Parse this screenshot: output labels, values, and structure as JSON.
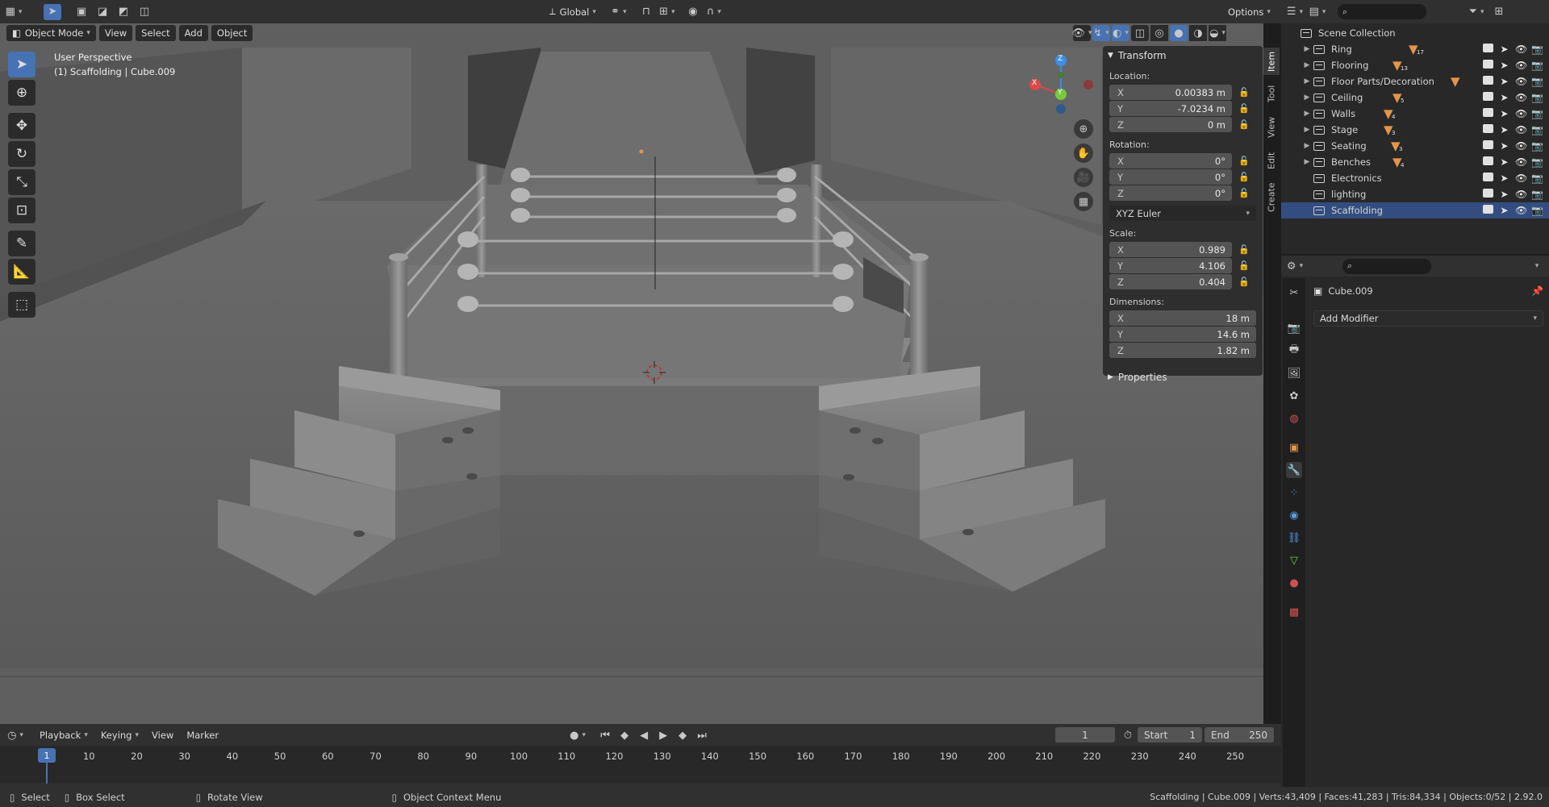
{
  "topbar": {
    "transform_orientation": "Global",
    "options": "Options"
  },
  "viewport": {
    "mode": "Object Mode",
    "menus": [
      "View",
      "Select",
      "Add",
      "Object"
    ],
    "perspective": "User Perspective",
    "object_info": "(1) Scaffolding | Cube.009"
  },
  "gizmo": {
    "x": "X",
    "y": "Y",
    "z": "Z"
  },
  "npanel": {
    "tabs": [
      "Item",
      "Tool",
      "View",
      "Edit",
      "Create"
    ],
    "transform": "Transform",
    "location_label": "Location:",
    "location": [
      {
        "axis": "X",
        "value": "0.00383 m"
      },
      {
        "axis": "Y",
        "value": "-7.0234 m"
      },
      {
        "axis": "Z",
        "value": "0 m"
      }
    ],
    "rotation_label": "Rotation:",
    "rotation": [
      {
        "axis": "X",
        "value": "0°"
      },
      {
        "axis": "Y",
        "value": "0°"
      },
      {
        "axis": "Z",
        "value": "0°"
      }
    ],
    "rotation_mode": "XYZ Euler",
    "scale_label": "Scale:",
    "scale": [
      {
        "axis": "X",
        "value": "0.989"
      },
      {
        "axis": "Y",
        "value": "4.106"
      },
      {
        "axis": "Z",
        "value": "0.404"
      }
    ],
    "dimensions_label": "Dimensions:",
    "dimensions": [
      {
        "axis": "X",
        "value": "18 m"
      },
      {
        "axis": "Y",
        "value": "14.6 m"
      },
      {
        "axis": "Z",
        "value": "1.82 m"
      }
    ],
    "properties": "Properties"
  },
  "outliner": {
    "root": "Scene Collection",
    "items": [
      {
        "label": "Ring",
        "badge": "17"
      },
      {
        "label": "Flooring",
        "badge": "13"
      },
      {
        "label": "Floor Parts/Decoration",
        "badge": ""
      },
      {
        "label": "Ceiling",
        "badge": "5"
      },
      {
        "label": "Walls",
        "badge": "4"
      },
      {
        "label": "Stage",
        "badge": "3"
      },
      {
        "label": "Seating",
        "badge": "3"
      },
      {
        "label": "Benches",
        "badge": "4"
      },
      {
        "label": "Electronics",
        "badge": ""
      },
      {
        "label": "lighting",
        "badge": ""
      },
      {
        "label": "Scaffolding",
        "badge": ""
      }
    ]
  },
  "properties": {
    "object_name": "Cube.009",
    "add_modifier": "Add Modifier"
  },
  "timeline": {
    "menus": [
      "Playback",
      "Keying",
      "View",
      "Marker"
    ],
    "current_frame": "1",
    "start_label": "Start",
    "start": "1",
    "end_label": "End",
    "end": "250",
    "ticks": [
      "1",
      "10",
      "20",
      "30",
      "40",
      "50",
      "60",
      "70",
      "80",
      "90",
      "100",
      "110",
      "120",
      "130",
      "140",
      "150",
      "160",
      "170",
      "180",
      "190",
      "200",
      "210",
      "220",
      "230",
      "240",
      "250"
    ]
  },
  "statusbar": {
    "select": "Select",
    "box_select": "Box Select",
    "rotate_view": "Rotate View",
    "context_menu": "Object Context Menu",
    "stats": "Scaffolding | Cube.009 | Verts:43,409 | Faces:41,283 | Tris:84,334 | Objects:0/52 | 2.92.0"
  },
  "colors": {
    "accent": "#4772b3",
    "selected_row": "#334d80",
    "mesh_icon": "#e69548",
    "axis_x": "#e04848",
    "axis_y": "#7ac83c",
    "axis_z": "#3c8ee6"
  }
}
